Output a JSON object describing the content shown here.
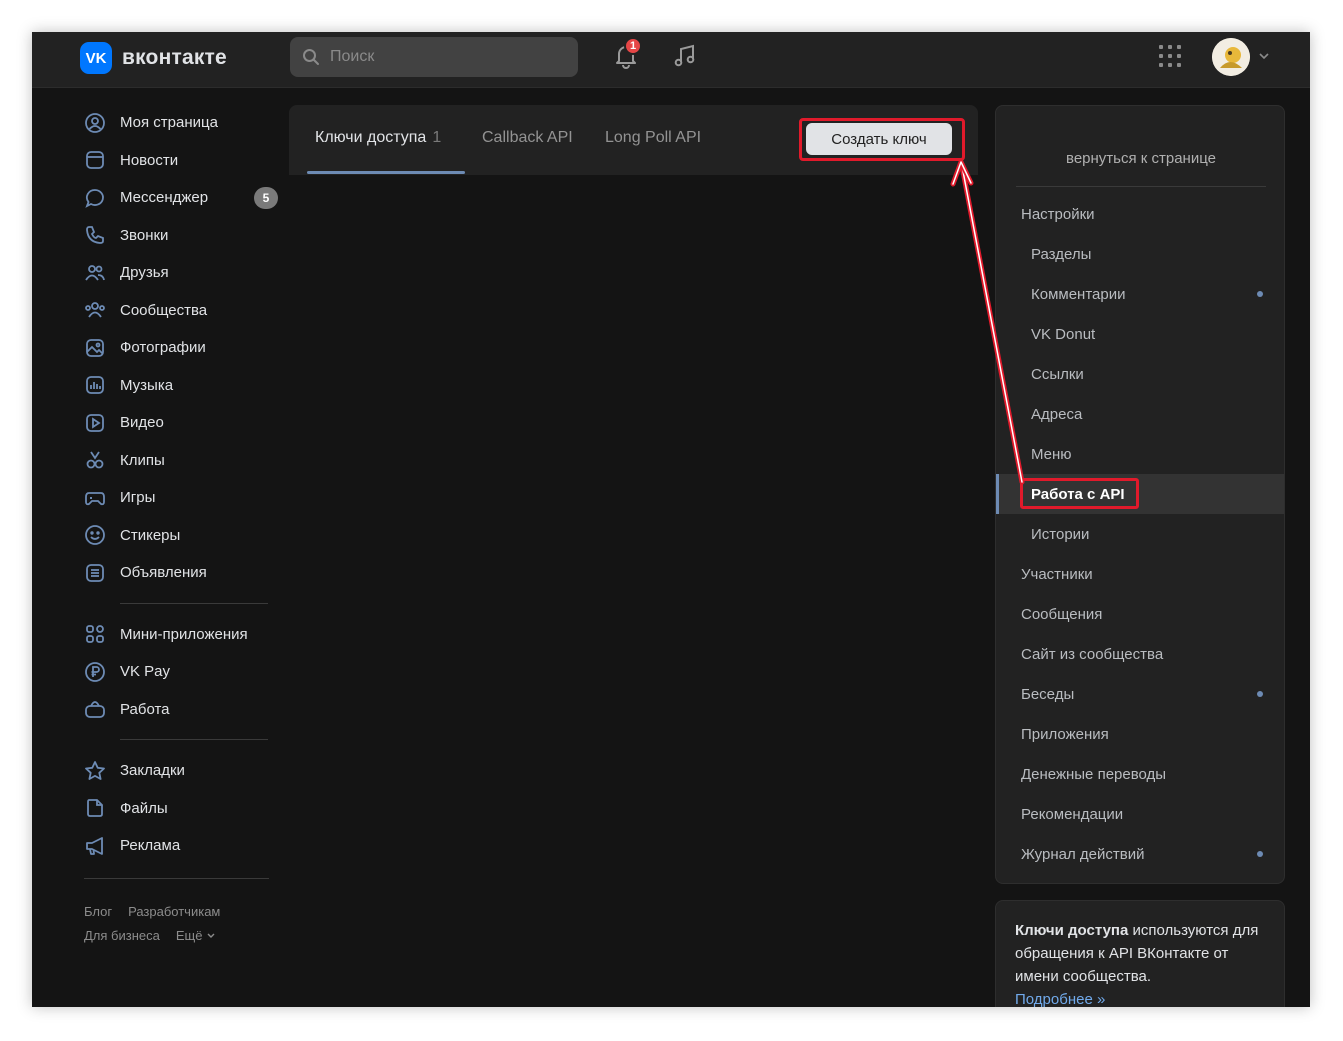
{
  "brand": {
    "name": "вконтакте",
    "logo_letters": "VK",
    "color": "#0077ff"
  },
  "search": {
    "placeholder": "Поиск"
  },
  "notifications": {
    "count": "1"
  },
  "left_nav": {
    "items": [
      {
        "label": "Моя страница",
        "icon": "user-circle-icon"
      },
      {
        "label": "Новости",
        "icon": "news-icon"
      },
      {
        "label": "Мессенджер",
        "icon": "message-icon",
        "badge": "5"
      },
      {
        "label": "Звонки",
        "icon": "phone-icon"
      },
      {
        "label": "Друзья",
        "icon": "friends-icon"
      },
      {
        "label": "Сообщества",
        "icon": "communities-icon"
      },
      {
        "label": "Фотографии",
        "icon": "photo-icon"
      },
      {
        "label": "Музыка",
        "icon": "music-icon"
      },
      {
        "label": "Видео",
        "icon": "video-icon"
      },
      {
        "label": "Клипы",
        "icon": "clips-icon"
      },
      {
        "label": "Игры",
        "icon": "gamepad-icon"
      },
      {
        "label": "Стикеры",
        "icon": "smile-icon"
      },
      {
        "label": "Объявления",
        "icon": "ads-board-icon"
      }
    ],
    "items2": [
      {
        "label": "Мини-приложения",
        "icon": "grid-icon"
      },
      {
        "label": "VK Pay",
        "icon": "ruble-icon"
      },
      {
        "label": "Работа",
        "icon": "briefcase-icon"
      }
    ],
    "items3": [
      {
        "label": "Закладки",
        "icon": "star-icon"
      },
      {
        "label": "Файлы",
        "icon": "file-icon"
      },
      {
        "label": "Реклама",
        "icon": "megaphone-icon"
      }
    ],
    "footer": [
      "Блог",
      "Разработчикам",
      "Для бизнеса",
      "Ещё"
    ]
  },
  "tabs": {
    "items": [
      {
        "label": "Ключи доступа",
        "count": "1"
      },
      {
        "label": "Callback API"
      },
      {
        "label": "Long Poll API"
      }
    ],
    "create_button": "Создать ключ"
  },
  "right_panel": {
    "back_link": "вернуться к странице",
    "items": [
      {
        "label": "Настройки",
        "level": 0
      },
      {
        "label": "Разделы",
        "level": 1
      },
      {
        "label": "Комментарии",
        "level": 1,
        "dot": true
      },
      {
        "label": "VK Donut",
        "level": 1
      },
      {
        "label": "Ссылки",
        "level": 1
      },
      {
        "label": "Адреса",
        "level": 1
      },
      {
        "label": "Меню",
        "level": 1
      },
      {
        "label": "Работа с API",
        "level": 1,
        "active": true
      },
      {
        "label": "Истории",
        "level": 1
      },
      {
        "label": "Участники",
        "level": 0
      },
      {
        "label": "Сообщения",
        "level": 0
      },
      {
        "label": "Сайт из сообщества",
        "level": 0
      },
      {
        "label": "Беседы",
        "level": 0,
        "dot": true
      },
      {
        "label": "Приложения",
        "level": 0
      },
      {
        "label": "Денежные переводы",
        "level": 0
      },
      {
        "label": "Рекомендации",
        "level": 0
      },
      {
        "label": "Журнал действий",
        "level": 0,
        "dot": true
      }
    ]
  },
  "info": {
    "bold": "Ключи доступа",
    "text": " используются для обращения к API ВКонтакте от имени сообщества.",
    "link": "Подробнее »"
  },
  "colors": {
    "accent": "#6d8bb4",
    "highlight": "#e11a2b",
    "background": "#141414",
    "panel": "#222222"
  }
}
